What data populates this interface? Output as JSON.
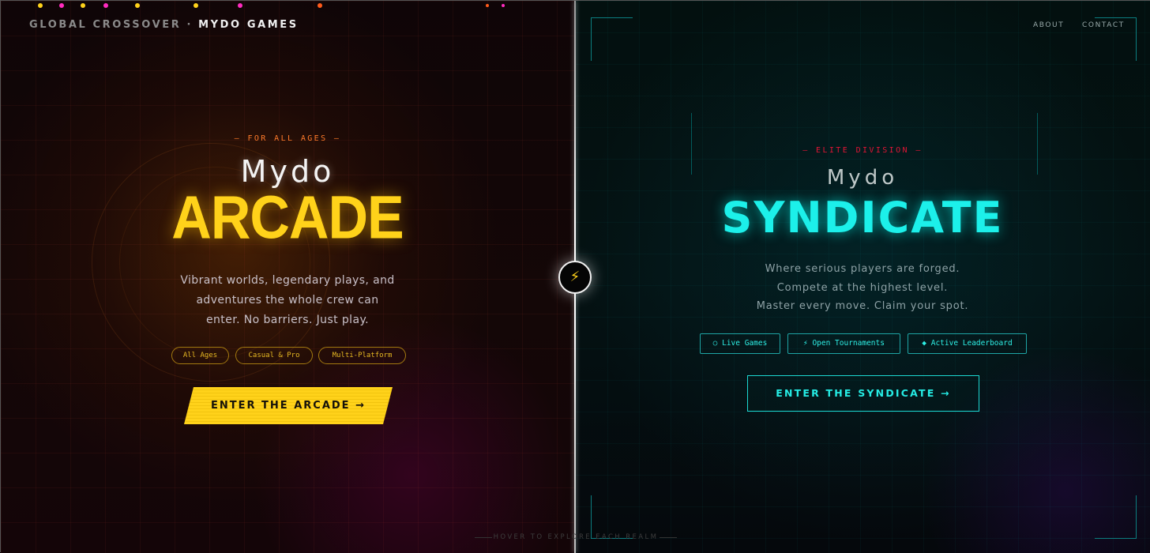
{
  "header": {
    "brand_prefix": "GLOBAL CROSSOVER · ",
    "brand_name": "MYDO GAMES",
    "nav": [
      "ABOUT",
      "CONTACT"
    ]
  },
  "center_icon": "⚡",
  "arcade": {
    "tag": "— FOR ALL AGES —",
    "mydo": "Mydo",
    "title": "ARCADE",
    "description": [
      "Vibrant worlds, legendary plays, and",
      "adventures the whole crew can",
      "enter. No barriers. Just play."
    ],
    "pills": [
      "All Ages",
      "Casual & Pro",
      "Multi-Platform"
    ],
    "cta": "ENTER THE ARCADE →"
  },
  "syndicate": {
    "tag": "— ELITE DIVISION —",
    "mydo": "Mydo",
    "title": "SYNDICATE",
    "description": [
      "Where serious players are forged.",
      "Compete at the highest level.",
      "Master every move. Claim your spot."
    ],
    "pills": [
      "○ Live Games",
      "⚡ Open Tournaments",
      "◆ Active Leaderboard"
    ],
    "cta": "ENTER THE SYNDICATE  →"
  },
  "footer_hint": "HOVER TO EXPLORE EACH REALM",
  "colors": {
    "arcade_accent": "#ffd21a",
    "arcade_tag": "#ff7a2a",
    "syndicate_accent": "#1cf0ea",
    "syndicate_tag": "#e01535"
  }
}
